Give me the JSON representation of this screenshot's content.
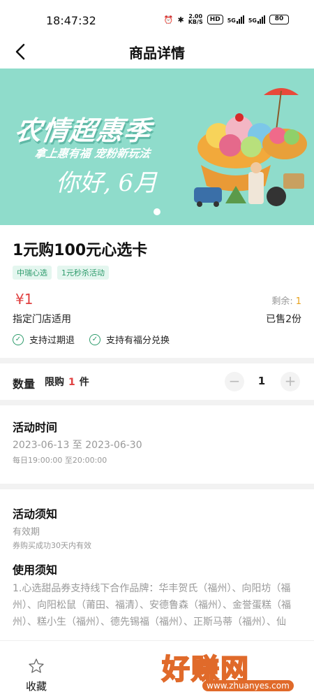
{
  "status": {
    "time": "18:47:32",
    "net_speed": "2.00",
    "net_unit": "KB/S",
    "hd": "HD",
    "sig1": "5G",
    "sig2": "5G",
    "battery": "80"
  },
  "nav": {
    "title": "商品详情"
  },
  "banner": {
    "title": "农情超惠季",
    "subtitle": "拿上惠有福 宠粉新玩法",
    "script": "你好, 6月"
  },
  "product": {
    "title": "1元购100元心选卡",
    "tags": [
      "中瑞心选",
      "1元秒杀活动"
    ],
    "price": "¥1",
    "remaining_label": "剩余:",
    "remaining_value": "1",
    "store": "指定门店适用",
    "sold": "已售2份",
    "guarantees": [
      "支持过期退",
      "支持有福分兑换"
    ]
  },
  "quantity": {
    "label": "数量",
    "limit_prefix": "限购",
    "limit_value": "1",
    "limit_suffix": "件",
    "minus": "−",
    "value": "1",
    "plus": "+"
  },
  "activity_time": {
    "heading": "活动时间",
    "range": "2023-06-13 至 2023-06-30",
    "daily": "每日19:00:00 至20:00:00"
  },
  "notice": {
    "heading": "活动须知",
    "validity_label": "有效期",
    "validity_text": "券购买成功30天内有效"
  },
  "usage": {
    "heading": "使用须知",
    "text": "1.心选甜品券支持线下合作品牌：华丰贺氏（福州）、向阳坊（福州）、向阳松鼠（莆田、福清）、安德鲁森（福州）、金誉蛋糕（福州）、糕小生（福州）、德先锡福（福州）、正斯马蒂（福州）、仙"
  },
  "bottom": {
    "favorite_label": "收藏"
  },
  "watermark": {
    "text": "好赚网",
    "url": "www.zhuanyes.com"
  },
  "colors": {
    "accent_green": "#2d9b6b",
    "price_red": "#e04040",
    "banner_bg": "#8fdccb",
    "remaining_orange": "#e8a21a"
  }
}
